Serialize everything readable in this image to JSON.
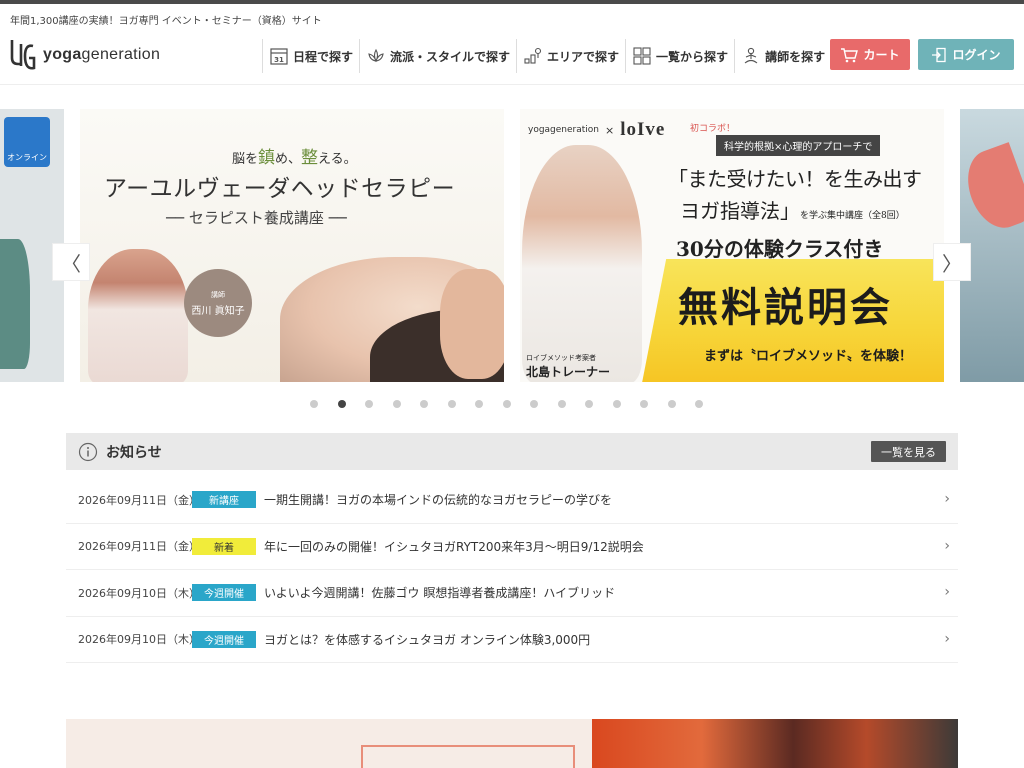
{
  "header": {
    "tagline": "年間1,300講座の実績！ヨガ専門 イベント・セミナー（資格）サイト",
    "logo_text_bold": "yoga",
    "logo_text_light": "generation",
    "nav": [
      {
        "label": "日程で探す",
        "icon": "calendar-icon"
      },
      {
        "label": "流派・スタイルで探す",
        "icon": "lotus-icon"
      },
      {
        "label": "エリアで探す",
        "icon": "map-pin-icon"
      },
      {
        "label": "一覧から探す",
        "icon": "grid-icon"
      },
      {
        "label": "講師を探す",
        "icon": "instructor-icon"
      }
    ],
    "calendar_day": "31",
    "cart_label": "カート",
    "login_label": "ログイン"
  },
  "carousel": {
    "slide_left_badge": "オンライン",
    "slide1": {
      "catch_1": "脳を",
      "catch_2": "鎮",
      "catch_3": "め、",
      "catch_4": "整",
      "catch_5": "える。",
      "title": "アーユルヴェーダヘッドセラピー",
      "subtitle": "── セラピスト養成講座 ──",
      "instructor_role": "講師",
      "instructor_name": "西川 眞知子"
    },
    "slide2": {
      "brand_yg": "yogageneration",
      "x": "×",
      "brand_loive": "loIve",
      "collab": "初コラボ！",
      "tag": "科学的根拠×心理的アプローチで",
      "head1": "「また受けたい！を生み出す",
      "head2": "ヨガ指導法」",
      "head2_small": "を学ぶ集中講座（全8回）",
      "trial": "30分の体験クラス付き",
      "free": "無料説明会",
      "first": "まずは〝ロイブメソッド〟を体験！",
      "trainer_role": "ロイブメソッド考案者",
      "trainer_name": "北島トレーナー"
    },
    "prev_label": "〈",
    "next_label": "〉",
    "dot_count": 15,
    "active_index": 1
  },
  "notice": {
    "title": "お知らせ",
    "view_all": "一覧を見る",
    "items": [
      {
        "date": "2026年09月11日（金）",
        "badge": "新講座",
        "badge_color": "#2aa6c9",
        "badge_text_color": "#ffffff",
        "text": "一期生開講！ヨガの本場インドの伝統的なヨガセラピーの学びを"
      },
      {
        "date": "2026年09月11日（金）",
        "badge": "新着",
        "badge_color": "#f1ec3a",
        "badge_text_color": "#333333",
        "text": "年に一回のみの開催！イシュタヨガRYT200来年3月～明日9/12説明会"
      },
      {
        "date": "2026年09月10日（木）",
        "badge": "今週開催",
        "badge_color": "#2aa6c9",
        "badge_text_color": "#ffffff",
        "text": "いよいよ今週開講！佐藤ゴウ 瞑想指導者養成講座！ハイブリッド"
      },
      {
        "date": "2026年09月10日（木）",
        "badge": "今週開催",
        "badge_color": "#2aa6c9",
        "badge_text_color": "#ffffff",
        "text": "ヨガとは？を体感するイシュタヨガ オンライン体験3,000円"
      }
    ]
  },
  "colors": {
    "cart": "#e86a6a",
    "login": "#6fb3b8",
    "accent_blue": "#2aa6c9"
  }
}
